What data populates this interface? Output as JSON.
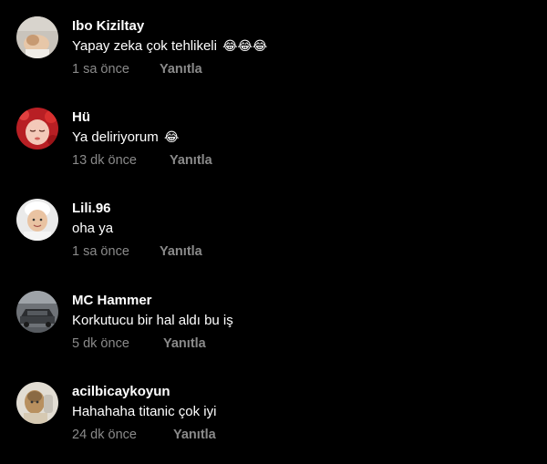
{
  "comments": [
    {
      "username": "Ibo Kiziltay",
      "text": "Yapay zeka çok tehlikeli",
      "emojis": "😂😂😂",
      "time": "1 sa önce",
      "reply": "Yanıtla"
    },
    {
      "username": "Hü",
      "text": "Ya deliriyorum",
      "emojis": "😂",
      "time": "13 dk önce",
      "reply": "Yanıtla"
    },
    {
      "username": "Lili.96",
      "text": "oha ya",
      "emojis": "",
      "time": "1 sa önce",
      "reply": "Yanıtla"
    },
    {
      "username": "MC Hammer",
      "text": "Korkutucu bir hal aldı bu iş",
      "emojis": "",
      "time": "5 dk önce",
      "reply": "Yanıtla"
    },
    {
      "username": "acilbicaykoyun",
      "text": "Hahahaha titanic çok iyi",
      "emojis": "",
      "time": "24 dk önce",
      "reply": "Yanıtla"
    }
  ]
}
